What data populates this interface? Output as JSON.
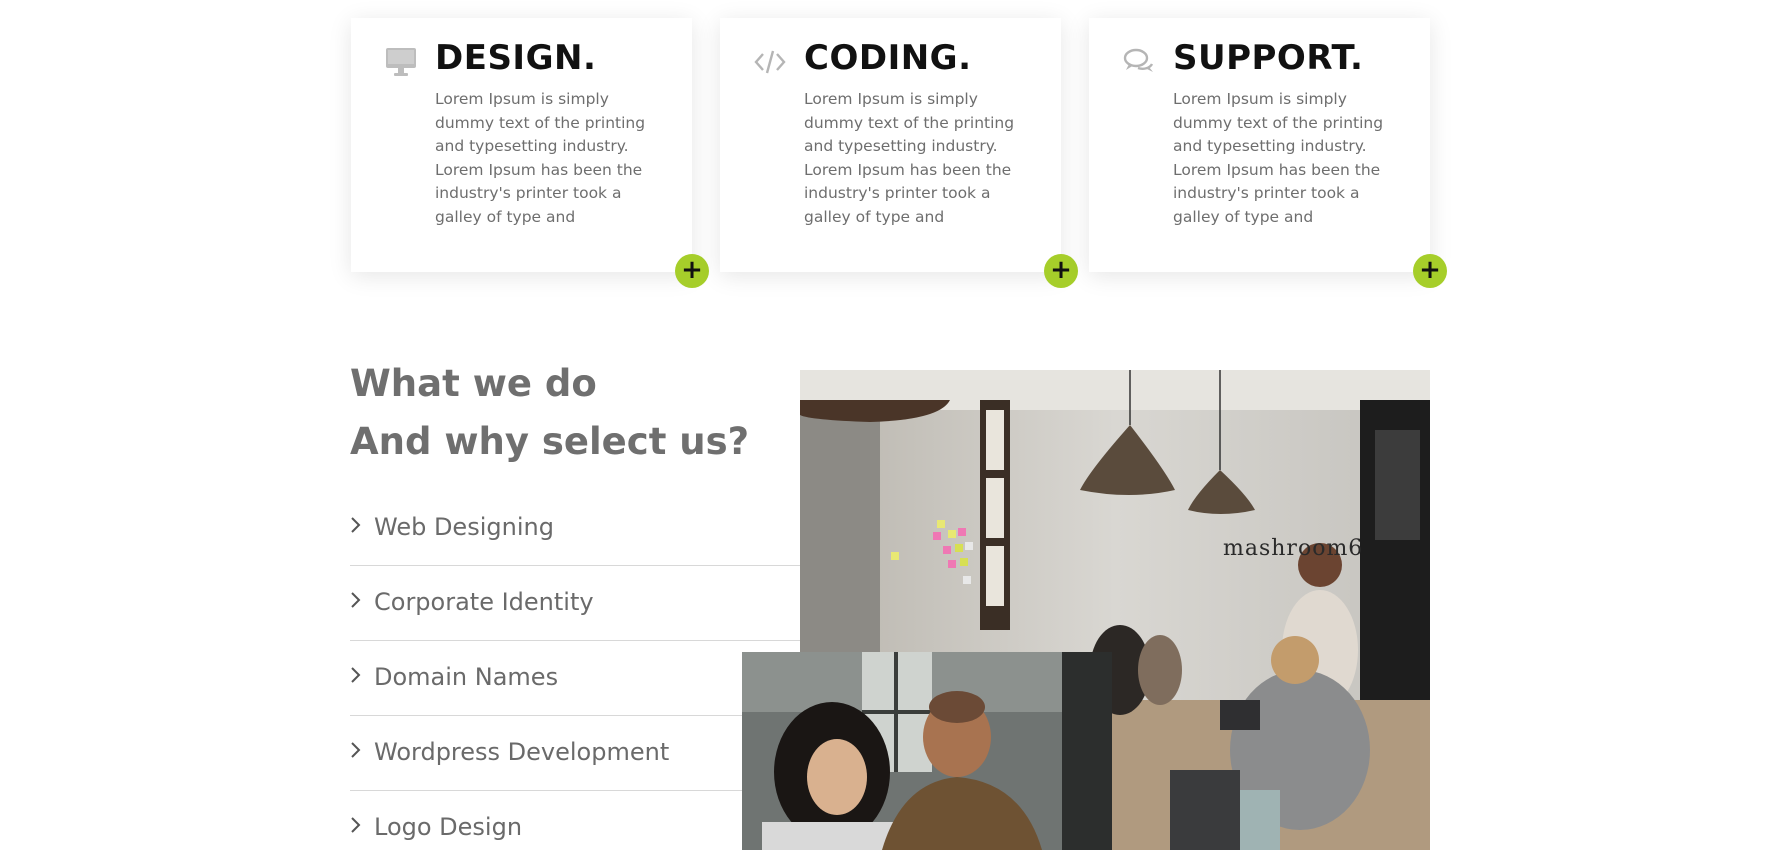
{
  "colors": {
    "accent": "#a6ce2a",
    "heading": "#6f6f6f",
    "body_text": "#6e6e6e",
    "card_title": "#111111"
  },
  "cards": [
    {
      "icon": "monitor-icon",
      "title": "DESIGN.",
      "text": "Lorem Ipsum is simply dummy text of the printing and typesetting industry. Lorem Ipsum has been the industry's printer took a galley of type and",
      "button": "+"
    },
    {
      "icon": "code-icon",
      "title": "CODING.",
      "text": "Lorem Ipsum is simply dummy text of the printing and typesetting industry. Lorem Ipsum has been the industry's printer took a galley of type and",
      "button": "+"
    },
    {
      "icon": "chat-bubbles-icon",
      "title": "SUPPORT.",
      "text": "Lorem Ipsum is simply dummy text of the printing and typesetting industry. Lorem Ipsum has been the industry's printer took a galley of type and",
      "button": "+"
    }
  ],
  "what_we_do": {
    "heading_line1": "What we do",
    "heading_line2": "And why select us?",
    "items": [
      {
        "label": "Web Designing",
        "icon": "chevron-right-icon"
      },
      {
        "label": "Corporate Identity",
        "icon": "chevron-right-icon"
      },
      {
        "label": "Domain Names",
        "icon": "chevron-right-icon"
      },
      {
        "label": "Wordpress Development",
        "icon": "chevron-right-icon"
      },
      {
        "label": "Logo Design",
        "icon": "chevron-right-icon"
      }
    ]
  },
  "photos": {
    "office_wall_sign": "mashroom6"
  }
}
